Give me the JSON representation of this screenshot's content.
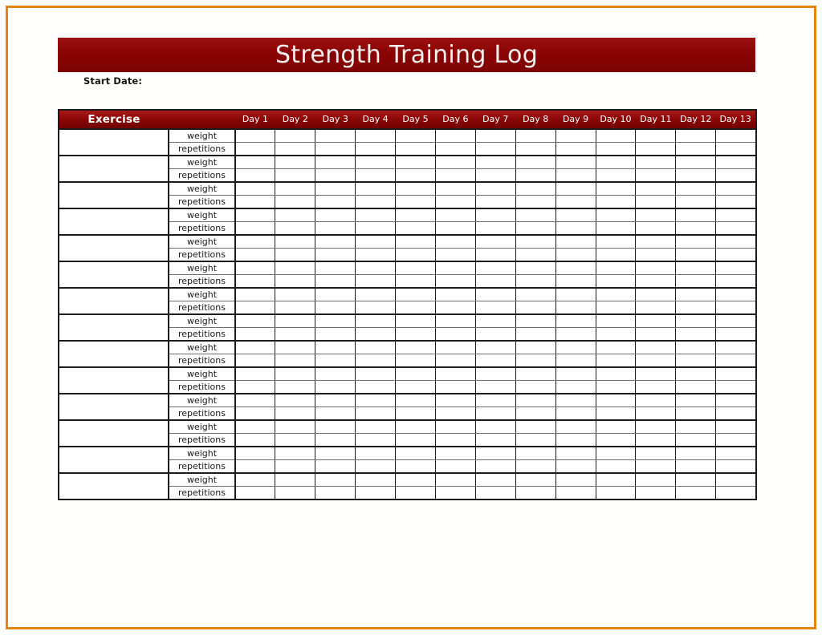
{
  "document": {
    "title": "Strength Training Log",
    "accent_color": "#8b0505",
    "page_border_color": "#e8820c",
    "title_text_color": "#f7efef"
  },
  "fields": {
    "start_date_label": "Start Date:",
    "start_date_value": ""
  },
  "table": {
    "exercise_header": "Exercise",
    "metric_header": "",
    "day_headers": [
      "Day 1",
      "Day 2",
      "Day 3",
      "Day 4",
      "Day 5",
      "Day 6",
      "Day 7",
      "Day 8",
      "Day 9",
      "Day 10",
      "Day 11",
      "Day 12",
      "Day 13"
    ],
    "metric_labels": [
      "weight",
      "repetitions"
    ],
    "exercise_rows": [
      {
        "name": "",
        "weight": [
          "",
          "",
          "",
          "",
          "",
          "",
          "",
          "",
          "",
          "",
          "",
          "",
          ""
        ],
        "repetitions": [
          "",
          "",
          "",
          "",
          "",
          "",
          "",
          "",
          "",
          "",
          "",
          "",
          ""
        ]
      },
      {
        "name": "",
        "weight": [
          "",
          "",
          "",
          "",
          "",
          "",
          "",
          "",
          "",
          "",
          "",
          "",
          ""
        ],
        "repetitions": [
          "",
          "",
          "",
          "",
          "",
          "",
          "",
          "",
          "",
          "",
          "",
          "",
          ""
        ]
      },
      {
        "name": "",
        "weight": [
          "",
          "",
          "",
          "",
          "",
          "",
          "",
          "",
          "",
          "",
          "",
          "",
          ""
        ],
        "repetitions": [
          "",
          "",
          "",
          "",
          "",
          "",
          "",
          "",
          "",
          "",
          "",
          "",
          ""
        ]
      },
      {
        "name": "",
        "weight": [
          "",
          "",
          "",
          "",
          "",
          "",
          "",
          "",
          "",
          "",
          "",
          "",
          ""
        ],
        "repetitions": [
          "",
          "",
          "",
          "",
          "",
          "",
          "",
          "",
          "",
          "",
          "",
          "",
          ""
        ]
      },
      {
        "name": "",
        "weight": [
          "",
          "",
          "",
          "",
          "",
          "",
          "",
          "",
          "",
          "",
          "",
          "",
          ""
        ],
        "repetitions": [
          "",
          "",
          "",
          "",
          "",
          "",
          "",
          "",
          "",
          "",
          "",
          "",
          ""
        ]
      },
      {
        "name": "",
        "weight": [
          "",
          "",
          "",
          "",
          "",
          "",
          "",
          "",
          "",
          "",
          "",
          "",
          ""
        ],
        "repetitions": [
          "",
          "",
          "",
          "",
          "",
          "",
          "",
          "",
          "",
          "",
          "",
          "",
          ""
        ]
      },
      {
        "name": "",
        "weight": [
          "",
          "",
          "",
          "",
          "",
          "",
          "",
          "",
          "",
          "",
          "",
          "",
          ""
        ],
        "repetitions": [
          "",
          "",
          "",
          "",
          "",
          "",
          "",
          "",
          "",
          "",
          "",
          "",
          ""
        ]
      },
      {
        "name": "",
        "weight": [
          "",
          "",
          "",
          "",
          "",
          "",
          "",
          "",
          "",
          "",
          "",
          "",
          ""
        ],
        "repetitions": [
          "",
          "",
          "",
          "",
          "",
          "",
          "",
          "",
          "",
          "",
          "",
          "",
          ""
        ]
      },
      {
        "name": "",
        "weight": [
          "",
          "",
          "",
          "",
          "",
          "",
          "",
          "",
          "",
          "",
          "",
          "",
          ""
        ],
        "repetitions": [
          "",
          "",
          "",
          "",
          "",
          "",
          "",
          "",
          "",
          "",
          "",
          "",
          ""
        ]
      },
      {
        "name": "",
        "weight": [
          "",
          "",
          "",
          "",
          "",
          "",
          "",
          "",
          "",
          "",
          "",
          "",
          ""
        ],
        "repetitions": [
          "",
          "",
          "",
          "",
          "",
          "",
          "",
          "",
          "",
          "",
          "",
          "",
          ""
        ]
      },
      {
        "name": "",
        "weight": [
          "",
          "",
          "",
          "",
          "",
          "",
          "",
          "",
          "",
          "",
          "",
          "",
          ""
        ],
        "repetitions": [
          "",
          "",
          "",
          "",
          "",
          "",
          "",
          "",
          "",
          "",
          "",
          "",
          ""
        ]
      },
      {
        "name": "",
        "weight": [
          "",
          "",
          "",
          "",
          "",
          "",
          "",
          "",
          "",
          "",
          "",
          "",
          ""
        ],
        "repetitions": [
          "",
          "",
          "",
          "",
          "",
          "",
          "",
          "",
          "",
          "",
          "",
          "",
          ""
        ]
      },
      {
        "name": "",
        "weight": [
          "",
          "",
          "",
          "",
          "",
          "",
          "",
          "",
          "",
          "",
          "",
          "",
          ""
        ],
        "repetitions": [
          "",
          "",
          "",
          "",
          "",
          "",
          "",
          "",
          "",
          "",
          "",
          "",
          ""
        ]
      },
      {
        "name": "",
        "weight": [
          "",
          "",
          "",
          "",
          "",
          "",
          "",
          "",
          "",
          "",
          "",
          "",
          ""
        ],
        "repetitions": [
          "",
          "",
          "",
          "",
          "",
          "",
          "",
          "",
          "",
          "",
          "",
          "",
          ""
        ]
      }
    ]
  }
}
